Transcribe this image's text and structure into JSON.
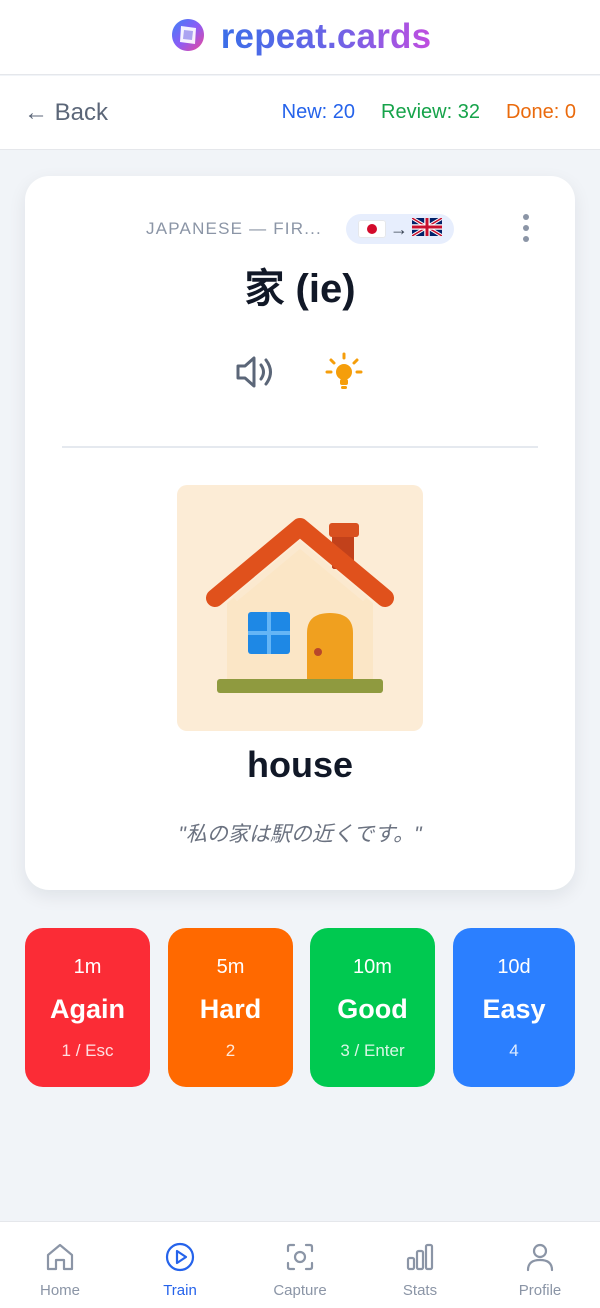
{
  "app": {
    "name": "repeat.cards"
  },
  "header": {
    "back_label": "← Back",
    "counts": {
      "new": "New: 20",
      "review": "Review: 32",
      "done": "Done: 0"
    }
  },
  "card": {
    "deck_label": "JAPANESE — FIR...",
    "language_pair": {
      "from": "jp-flag-icon",
      "arrow": "→",
      "to": "uk-flag-icon"
    },
    "term": "家 (ie)",
    "image": "house-illustration",
    "answer": "house",
    "example": "\"私の家は駅の近くです。\""
  },
  "ratings": [
    {
      "interval": "1m",
      "label": "Again",
      "key": "1 / Esc",
      "color": "#fb2c36"
    },
    {
      "interval": "5m",
      "label": "Hard",
      "key": "2",
      "color": "#ff6900"
    },
    {
      "interval": "10m",
      "label": "Good",
      "key": "3 / Enter",
      "color": "#00c950"
    },
    {
      "interval": "10d",
      "label": "Easy",
      "key": "4",
      "color": "#2b7fff"
    }
  ],
  "nav": {
    "items": [
      {
        "label": "Home",
        "icon": "home-icon"
      },
      {
        "label": "Train",
        "icon": "play-circle-icon",
        "active": true
      },
      {
        "label": "Capture",
        "icon": "camera-scan-icon"
      },
      {
        "label": "Stats",
        "icon": "bar-chart-icon"
      },
      {
        "label": "Profile",
        "icon": "user-icon"
      }
    ]
  },
  "colors": {
    "brand_gradient": [
      "#3b6ee8",
      "#c04ee0"
    ],
    "new": "#2563eb",
    "review": "#16a34a",
    "done": "#ea6a0c",
    "nav_active": "#2563eb"
  }
}
